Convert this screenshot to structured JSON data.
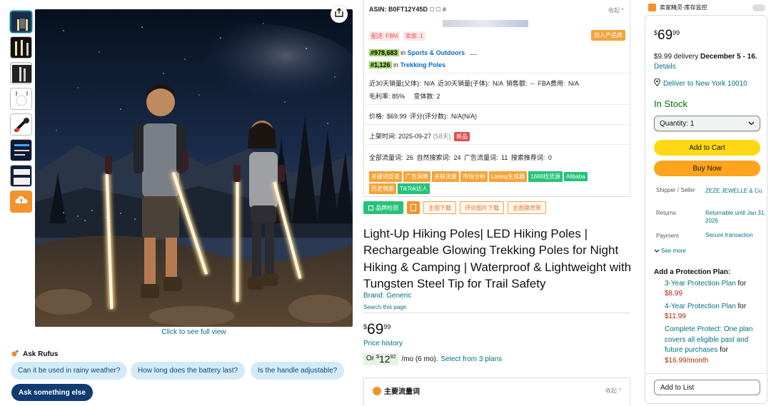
{
  "gallery": {
    "thumbnails": [
      "thumb-1",
      "thumb-2",
      "thumb-3",
      "thumb-4",
      "thumb-5",
      "thumb-6",
      "thumb-7"
    ],
    "full_view_label": "Click to see full view"
  },
  "rufus": {
    "title": "Ask Rufus",
    "chips": [
      "Can it be used in rainy weather?",
      "How long does the battery last?",
      "Is the handle adjustable?"
    ],
    "ask_else": "Ask something else"
  },
  "seller_panel": {
    "asin_label": "ASIN: B0FT12Y45D",
    "collapse": "收起",
    "tag_fbm": "配送: FBM",
    "tag_sellers": "卖家: 1",
    "add_product": "加入产品库",
    "rank1": "#978,683",
    "rank1_in": "in",
    "rank1_cat": "Sports & Outdoors",
    "rank2": "#1,126",
    "rank2_in": "in",
    "rank2_cat": "Trekking Poles",
    "row1": "近30天销量(父体): N/A    近30天销量(子体): N/A    销售额: --    FBA费用: N/A",
    "row2_a": "毛利率: 85%",
    "row2_b": "变体数: 2",
    "price_row": "价格: $69.99    评分(评分数): N/A(N/A)",
    "listed_row": "上架时间: 2025-09-27",
    "listed_days": "(58天)",
    "new_tag": "新品",
    "keywords_row": "全部流量词: 26    自然搜索词: 24    广告流量词: 11    搜索推荐词: 0",
    "tools": [
      "关键词反查",
      "广告洞察",
      "关联流量",
      "市场分析",
      "Listing生成器",
      "1688找货源",
      "Alibaba"
    ],
    "tools2": [
      "历史销量",
      "TikTok达人"
    ]
  },
  "actions": {
    "brand_check": "品牌检测",
    "main_img_download": "主图下载",
    "review_img_download": "评论图片下载",
    "main_bg_replace": "主图换背景"
  },
  "product": {
    "title": "Light-Up Hiking Poles| LED Hiking Poles | Rechargeable Glowing Trekking Poles for Night Hiking & Camping | Waterproof & Lightweight with Tungsten Steel Tip for Trail Safety",
    "brand": "Brand: Generic",
    "search_page": "Search this page",
    "price_currency": "$",
    "price_whole": "69",
    "price_fraction": "99",
    "price_history": "Price history",
    "monthly_or": "Or",
    "monthly_currency": "$",
    "monthly_whole": "12",
    "monthly_fraction": "92",
    "monthly_term": "/mo (6 mo).",
    "monthly_plans": "Select from 3 plans",
    "traffic_title": "主要流量词",
    "traffic_collapse": "收起"
  },
  "extension": {
    "title": "卖家精灵-库存监控"
  },
  "buybox": {
    "price_currency": "$",
    "price_whole": "69",
    "price_fraction": "99",
    "delivery_prefix": "$9.99 delivery",
    "delivery_dates": "December 5 - 16.",
    "details": "Details",
    "deliver_to": "Deliver to New York 10010",
    "stock": "In Stock",
    "quantity": "Quantity: 1",
    "add_to_cart": "Add to Cart",
    "buy_now": "Buy Now",
    "shipper_label": "Shipper / Seller",
    "shipper_value": "ZEZE JEWELLE & Co.",
    "returns_label": "Returns",
    "returns_value": "Returnable until Jan 31, 2026",
    "payment_label": "Payment",
    "payment_value": "Secure transaction",
    "see_more": "See more",
    "protection_title": "Add a Protection Plan:",
    "plan1_name": "3-Year Protection Plan",
    "plan1_for": "for",
    "plan1_price": "$8.99",
    "plan2_name": "4-Year Protection Plan",
    "plan2_for": "for",
    "plan2_price": "$11.99",
    "plan3_name": "Complete Protect: One plan covers all eligible past and future purchases",
    "plan3_for": "for",
    "plan3_price": "$16.99/month",
    "add_to_list": "Add to List"
  },
  "colors": {
    "link": "#007185",
    "price_red": "#b12704",
    "cart_yellow": "#ffd814",
    "buy_orange": "#ffa41c",
    "stock_green": "#007600",
    "rank_green": "#a3d464"
  }
}
